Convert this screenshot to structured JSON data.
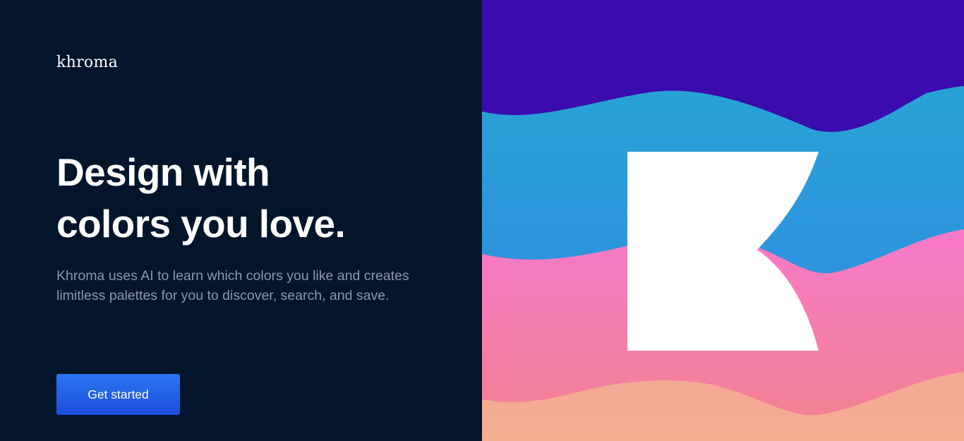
{
  "brand": {
    "name": "khroma"
  },
  "hero": {
    "title_line1": "Design with",
    "title_line2": "colors you love.",
    "description": "Khroma uses AI to learn which colors you like and creates limitless palettes for you to discover, search, and save."
  },
  "cta": {
    "label": "Get started"
  },
  "colors": {
    "background": "#02152B",
    "accent": "#1F5BE5",
    "band_purple": "#3A0CAE",
    "band_blue": "#2A9DD8",
    "band_pink": "#F77AC5",
    "band_peach": "#F5AA94",
    "logo_mark": "#FFFFFF"
  },
  "illustration": {
    "logo_icon": "khroma-k-icon"
  }
}
